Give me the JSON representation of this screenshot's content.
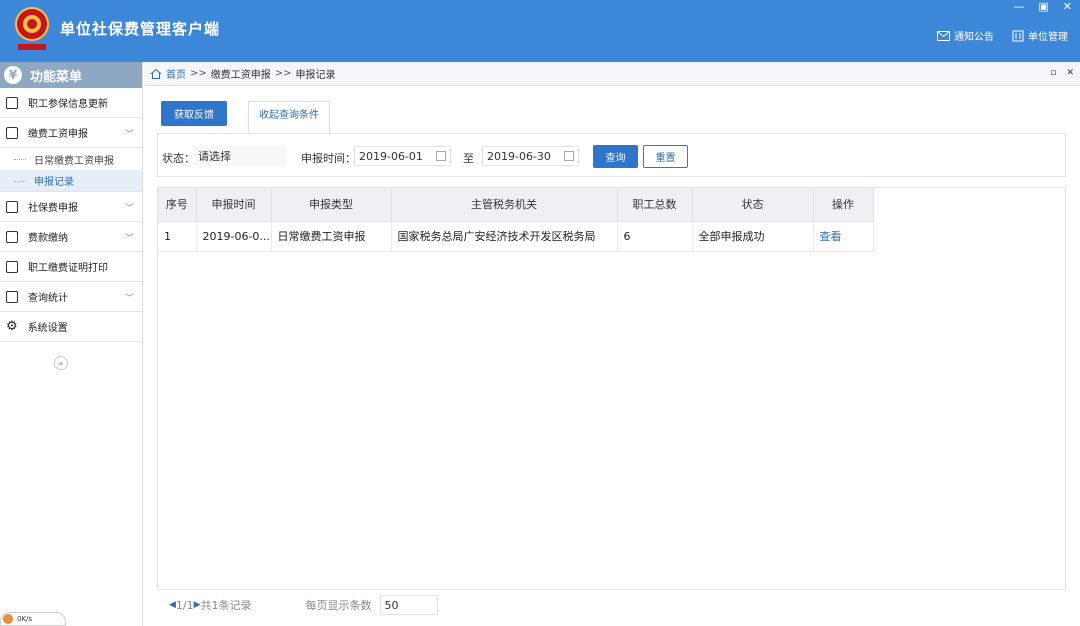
{
  "header": {
    "title": "单位社保费管理客户端",
    "links": [
      {
        "label": "通知公告",
        "icon": "mail-icon"
      },
      {
        "label": "单位管理",
        "icon": "building-icon"
      }
    ],
    "window_controls": [
      "—",
      "▣",
      "✕"
    ],
    "color": "#3d87d8"
  },
  "sidebar": {
    "title": "功能菜单",
    "items": [
      {
        "label": "职工参保信息更新",
        "icon": "list-icon",
        "has_children": false
      },
      {
        "label": "缴费工资申报",
        "icon": "edit-icon",
        "has_children": true,
        "children": [
          {
            "label": "日常缴费工资申报",
            "active": false
          },
          {
            "label": "申报记录",
            "active": true
          }
        ]
      },
      {
        "label": "社保费申报",
        "icon": "form-icon",
        "has_children": true
      },
      {
        "label": "费款缴纳",
        "icon": "book-icon",
        "has_children": true
      },
      {
        "label": "职工缴费证明打印",
        "icon": "printer-icon",
        "has_children": false
      },
      {
        "label": "查询统计",
        "icon": "chart-icon",
        "has_children": true
      },
      {
        "label": "系统设置",
        "icon": "gear-icon",
        "has_children": false
      }
    ],
    "collapse_label": "«",
    "net_speed": "0K/s"
  },
  "breadcrumb": {
    "home": "首页",
    "sep": ">>",
    "level2": "缴费工资申报",
    "level3": "申报记录"
  },
  "toolbar": {
    "get_feedback": "获取反馈",
    "collapse_query": "收起查询条件"
  },
  "filter": {
    "status_label": "状态：",
    "status_value": "请选择",
    "time_label": "申报时间：",
    "date_from": "2019-06-01",
    "to_label": "至",
    "date_to": "2019-06-30",
    "query_btn": "查询",
    "reset_btn": "重置"
  },
  "table": {
    "columns": [
      "序号",
      "申报时间",
      "申报类型",
      "主管税务机关",
      "职工总数",
      "状态",
      "操作"
    ],
    "rows": [
      [
        "1",
        "2019-06-0...",
        "日常缴费工资申报",
        "国家税务总局广安经济技术开发区税务局",
        "6",
        "全部申报成功",
        "查看"
      ]
    ]
  },
  "pager": {
    "summary": "1/1",
    "total": "共1条记录",
    "page_size_label": "每页显示条数",
    "page_size": "50"
  }
}
